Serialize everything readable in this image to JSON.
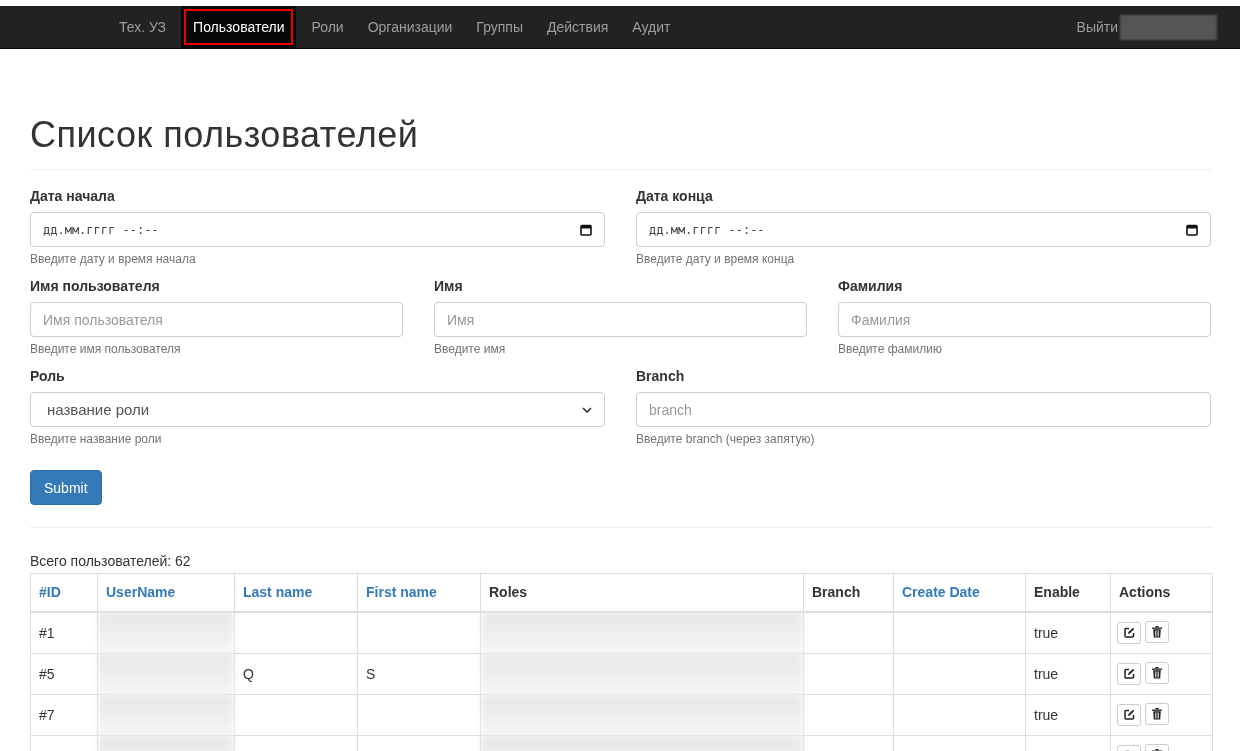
{
  "nav": {
    "items": [
      {
        "label": "Тех. УЗ",
        "selected": false
      },
      {
        "label": "Пользователи",
        "selected": true
      },
      {
        "label": "Роли",
        "selected": false
      },
      {
        "label": "Организации",
        "selected": false
      },
      {
        "label": "Группы",
        "selected": false
      },
      {
        "label": "Действия",
        "selected": false
      },
      {
        "label": "Аудит",
        "selected": false
      }
    ],
    "logout": "Выйти",
    "user_blurred": true
  },
  "title": "Список пользователей",
  "filters": [
    [
      {
        "kind": "datetime",
        "label": "Дата начала",
        "placeholder": "дд.мм.гггг --:--",
        "help": "Введите дату и время начала"
      },
      {
        "kind": "datetime",
        "label": "Дата конца",
        "placeholder": "дд.мм.гггг --:--",
        "help": "Введите дату и время конца"
      }
    ],
    [
      {
        "kind": "text",
        "label": "Имя пользователя",
        "placeholder": "Имя пользователя",
        "help": "Введите имя пользователя"
      },
      {
        "kind": "text",
        "label": "Имя",
        "placeholder": "Имя",
        "help": "Введите имя"
      },
      {
        "kind": "text",
        "label": "Фамилия",
        "placeholder": "Фамилия",
        "help": "Введите фамилию"
      }
    ],
    [
      {
        "kind": "select",
        "label": "Роль",
        "value": "название роли",
        "help": "Введите название роли"
      },
      {
        "kind": "text",
        "label": "Branch",
        "placeholder": "branch",
        "help": "Введите branch (через запятую)"
      }
    ]
  ],
  "submit": "Submit",
  "total": "Всего пользователей: 62",
  "table": {
    "columns": [
      {
        "label": "#ID",
        "sortable": true
      },
      {
        "label": "UserName",
        "sortable": true
      },
      {
        "label": "Last name",
        "sortable": true
      },
      {
        "label": "First name",
        "sortable": true
      },
      {
        "label": "Roles",
        "sortable": false
      },
      {
        "label": "Branch",
        "sortable": false
      },
      {
        "label": "Create Date",
        "sortable": true
      },
      {
        "label": "Enable",
        "sortable": false
      },
      {
        "label": "Actions",
        "sortable": false
      }
    ],
    "rows": [
      {
        "id": "#1",
        "username_blurred": true,
        "roles_blurred": true,
        "enable": "true"
      },
      {
        "id": "#5",
        "username_blurred": true,
        "last_name": "Q",
        "first_name": "S",
        "roles_blurred": true,
        "enable": "true"
      },
      {
        "id": "#7",
        "username_blurred": true,
        "roles_blurred": true,
        "enable": "true"
      },
      {
        "username_blurred": true,
        "roles_blurred": true
      }
    ]
  }
}
